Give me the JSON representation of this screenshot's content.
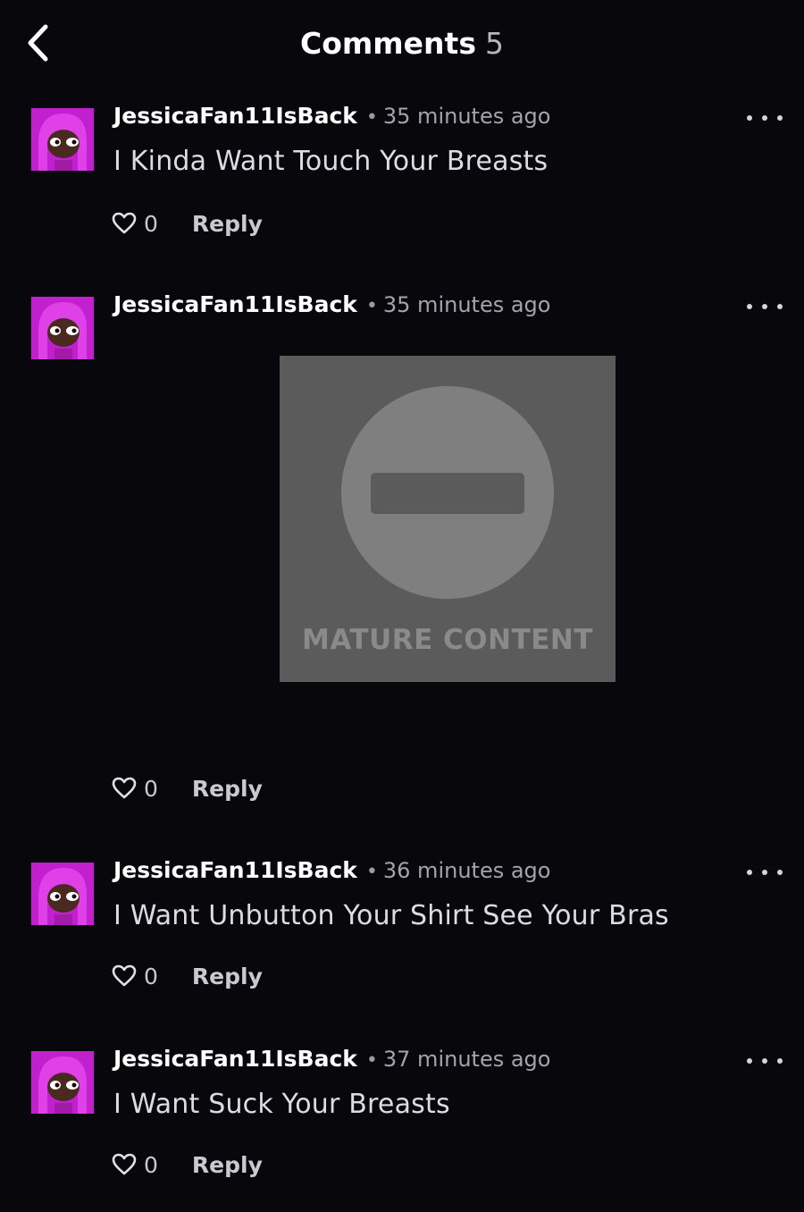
{
  "header": {
    "back_icon": "chevron-left-icon",
    "title": "Comments",
    "count": "5"
  },
  "avatar_colors": {
    "background": "#c21fcf",
    "hair": "#e040e8",
    "skin": "#4a2a20"
  },
  "comments": [
    {
      "username": "JessicaFan11IsBack",
      "separator": "•",
      "time": "35 minutes ago",
      "text": "I Kinda Want Touch Your Breasts",
      "like_count": "0",
      "reply_label": "Reply"
    },
    {
      "username": "JessicaFan11IsBack",
      "separator": "•",
      "time": "35 minutes ago",
      "media_label": "MATURE CONTENT",
      "media_icon": "no-entry-icon",
      "like_count": "0",
      "reply_label": "Reply"
    },
    {
      "username": "JessicaFan11IsBack",
      "separator": "•",
      "time": "36 minutes ago",
      "text": "I Want Unbutton Your Shirt See Your Bras",
      "like_count": "0",
      "reply_label": "Reply"
    },
    {
      "username": "JessicaFan11IsBack",
      "separator": "•",
      "time": "37 minutes ago",
      "text": "I Want Suck Your Breasts",
      "like_count": "0",
      "reply_label": "Reply"
    }
  ]
}
